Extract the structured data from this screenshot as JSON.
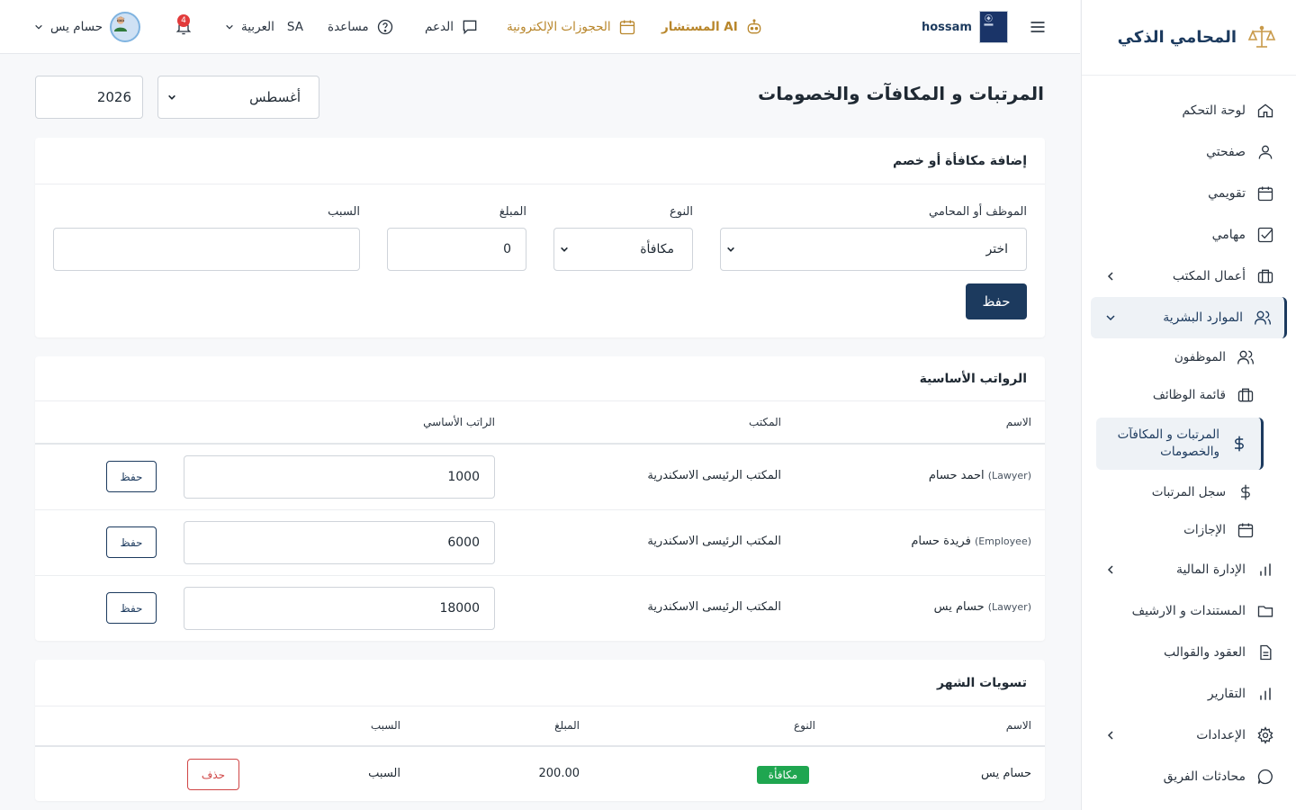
{
  "sidebar": {
    "brand": "المحامي الذكي",
    "items": [
      {
        "label": "لوحة التحكم"
      },
      {
        "label": "صفحتي"
      },
      {
        "label": "تقويمي"
      },
      {
        "label": "مهامي"
      },
      {
        "label": "أعمال المكتب"
      },
      {
        "label": "الموارد البشرية"
      }
    ],
    "hr_sub": [
      {
        "label": "الموظفون"
      },
      {
        "label": "قائمة الوظائف"
      },
      {
        "label": "المرتبات و المكافآت والخصومات"
      },
      {
        "label": "سجل المرتبات"
      },
      {
        "label": "الإجازات"
      }
    ],
    "items2": [
      {
        "label": "الإدارة المالية"
      },
      {
        "label": "المستندات و الارشيف"
      },
      {
        "label": "العقود والقوالب"
      },
      {
        "label": "التقارير"
      },
      {
        "label": "الإعدادات"
      },
      {
        "label": "محادثات الفريق"
      }
    ]
  },
  "header": {
    "username": "hossam",
    "ai_label": "المستشار AI",
    "bookings": "الحجوزات الإلكترونية",
    "support": "الدعم",
    "help": "مساعدة",
    "lang_code": "SA",
    "lang": "العربية",
    "notif_count": "4",
    "profile_name": "حسام يس"
  },
  "main": {
    "title": "المرتبات و المكافآت والخصومات",
    "month": "أغسطس",
    "year": "2026"
  },
  "add_card": {
    "title": "إضافة مكافأة أو خصم",
    "employee_label": "الموظف أو المحامي",
    "employee_value": "اختر",
    "type_label": "النوع",
    "type_value": "مكافأة",
    "amount_label": "المبلغ",
    "amount_value": "0",
    "reason_label": "السبب",
    "reason_value": "",
    "save": "حفظ"
  },
  "salaries": {
    "title": "الرواتب الأساسية",
    "headers": {
      "name": "الاسم",
      "office": "المكتب",
      "salary": "الراتب الأساسي"
    },
    "rows": [
      {
        "name": "احمد حسام",
        "role": "(Lawyer)",
        "office": "المكتب الرئيسى الاسكندرية",
        "salary": "1000",
        "action": "حفظ"
      },
      {
        "name": "فريدة حسام",
        "role": "(Employee)",
        "office": "المكتب الرئيسى الاسكندرية",
        "salary": "6000",
        "action": "حفظ"
      },
      {
        "name": "حسام يس",
        "role": "(Lawyer)",
        "office": "المكتب الرئيسى الاسكندرية",
        "salary": "18000",
        "action": "حفظ"
      }
    ]
  },
  "adjustments": {
    "title": "تسويات الشهر",
    "headers": {
      "name": "الاسم",
      "type": "النوع",
      "amount": "المبلغ",
      "reason": "السبب"
    },
    "rows": [
      {
        "name": "حسام يس",
        "type": "مكافأة",
        "amount": "200.00",
        "reason": "السبب",
        "action": "حذف"
      }
    ]
  },
  "colors": {
    "primary": "#1c3a5e",
    "gold": "#b8862b",
    "success": "#1fa650",
    "danger": "#d04545"
  }
}
